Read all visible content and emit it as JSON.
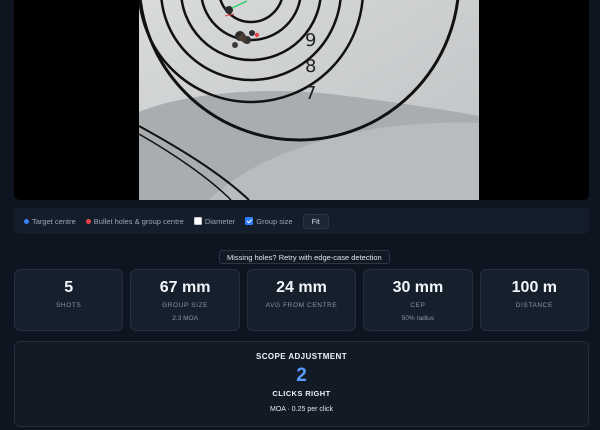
{
  "target": {
    "ring_numbers": [
      "9",
      "8",
      "7"
    ]
  },
  "legend": {
    "target_centre": "Target centre",
    "bullet_holes": "Bullet holes & group centre",
    "diameter": "Diameter",
    "group_size": "Group size",
    "fit": "Fit",
    "diameter_checked": false,
    "group_size_checked": true,
    "target_centre_color": "#3b82f6",
    "bullet_color": "#ef4444"
  },
  "retry_label": "Missing holes? Retry with edge-case detection",
  "stats": [
    {
      "value": "5",
      "label": "SHOTS",
      "sub": ""
    },
    {
      "value": "67 mm",
      "label": "GROUP SIZE",
      "sub": "2.3 MOA"
    },
    {
      "value": "24 mm",
      "label": "AVG FROM CENTRE",
      "sub": ""
    },
    {
      "value": "30 mm",
      "label": "CEP",
      "sub": "50% radius"
    },
    {
      "value": "100 m",
      "label": "DISTANCE",
      "sub": ""
    }
  ],
  "scope": {
    "title": "SCOPE ADJUSTMENT",
    "clicks": "2",
    "direction": "CLICKS RIGHT",
    "note": "MOA · 0.25 per click"
  }
}
